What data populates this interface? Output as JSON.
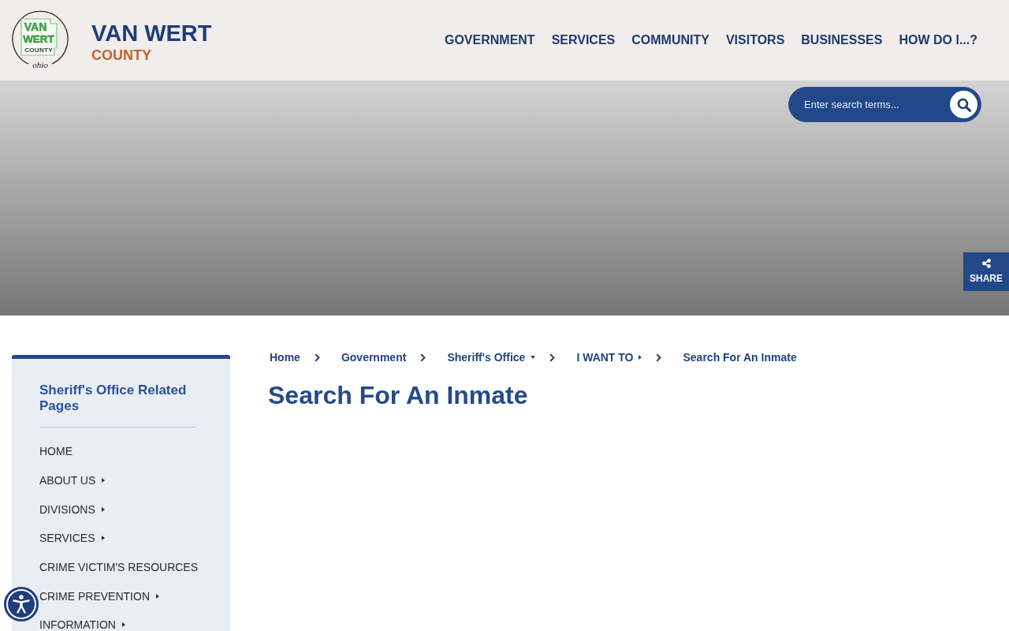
{
  "header": {
    "logo": {
      "lines": [
        "VAN",
        "WERT",
        "COUNTY",
        "ohio"
      ]
    },
    "site_title": "VAN WERT",
    "site_subtitle": "COUNTY"
  },
  "nav": [
    "GOVERNMENT",
    "SERVICES",
    "COMMUNITY",
    "VISITORS",
    "BUSINESSES",
    "HOW DO I...?"
  ],
  "search": {
    "placeholder": "Enter search terms..."
  },
  "share": {
    "label": "SHARE"
  },
  "sidebar": {
    "title": "Sheriff's Office Related Pages",
    "items": [
      {
        "label": "HOME",
        "submenu": false
      },
      {
        "label": "ABOUT US",
        "submenu": true
      },
      {
        "label": "DIVISIONS",
        "submenu": true
      },
      {
        "label": "SERVICES",
        "submenu": true
      },
      {
        "label": "CRIME VICTIM'S RESOURCES",
        "submenu": false
      },
      {
        "label": "CRIME PREVENTION",
        "submenu": true
      },
      {
        "label": "INFORMATION",
        "submenu": true
      }
    ]
  },
  "breadcrumb": [
    {
      "label": "Home",
      "kind": "plain"
    },
    {
      "label": "Government",
      "kind": "plain"
    },
    {
      "label": "Sheriff's Office",
      "kind": "dropdown"
    },
    {
      "label": "I WANT TO",
      "kind": "submenu"
    },
    {
      "label": "Search For An Inmate",
      "kind": "plain"
    }
  ],
  "page_title": "Search For An Inmate"
}
